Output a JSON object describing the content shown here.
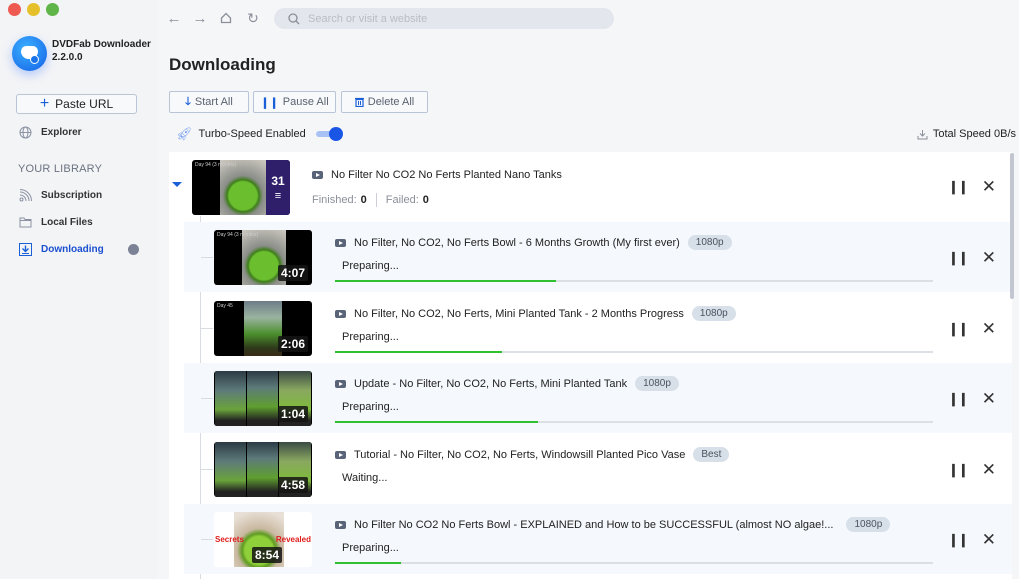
{
  "app": {
    "name": "DVDFab Downloader",
    "version": "2.2.0.0"
  },
  "sidebar": {
    "paste_url": "Paste URL",
    "explorer": "Explorer",
    "library_heading": "YOUR LIBRARY",
    "items": [
      {
        "label": "Subscription",
        "icon": "rss-icon"
      },
      {
        "label": "Local Files",
        "icon": "folder-icon"
      },
      {
        "label": "Downloading",
        "icon": "download-tray-icon",
        "active": true
      }
    ]
  },
  "topbar": {
    "search_placeholder": "Search or visit a website"
  },
  "page": {
    "title": "Downloading"
  },
  "toolbar": {
    "start_all": "Start All",
    "pause_all": "Pause All",
    "delete_all": "Delete All"
  },
  "turbo": {
    "label": "Turbo-Speed Enabled",
    "enabled": true
  },
  "total_speed": "Total Speed 0B/s",
  "group": {
    "title": "No Filter No CO2 No Ferts Planted Nano Tanks",
    "count": "31",
    "thumb_caption": "Day 94 (3 months)",
    "finished_label": "Finished:",
    "finished": "0",
    "failed_label": "Failed:",
    "failed": "0"
  },
  "items": [
    {
      "title": "No Filter, No CO2, No Ferts Bowl - 6 Months Growth (My first ever)",
      "quality": "1080p",
      "status": "Preparing...",
      "duration": "4:07",
      "progress": 0.37,
      "thumb_caption": "Day 94 (3 months)"
    },
    {
      "title": "No Filter, No CO2, No Ferts, Mini Planted Tank - 2 Months Progress",
      "quality": "1080p",
      "status": "Preparing...",
      "duration": "2:06",
      "progress": 0.28,
      "thumb_caption": "Day 45"
    },
    {
      "title": "Update - No Filter, No CO2, No Ferts, Mini Planted Tank",
      "quality": "1080p",
      "status": "Preparing...",
      "duration": "1:04",
      "progress": 0.34,
      "thumb_caption": ""
    },
    {
      "title": "Tutorial - No Filter, No CO2, No Ferts, Windowsill Planted Pico Vase",
      "quality": "Best",
      "status": "Waiting...",
      "duration": "4:58",
      "progress": null,
      "thumb_caption": ""
    },
    {
      "title": "No Filter No CO2 No Ferts Bowl - EXPLAINED and How to be SUCCESSFUL (almost NO algae!...",
      "quality": "1080p",
      "status": "Preparing...",
      "duration": "8:54",
      "progress": 0.11,
      "thumb_caption": "",
      "thumb_text_left": "Secrets",
      "thumb_text_right": "Revealed"
    }
  ],
  "colors": {
    "accent": "#1a5fd8",
    "progress": "#2fbf2f",
    "active_nav": "#1a4fd0"
  }
}
